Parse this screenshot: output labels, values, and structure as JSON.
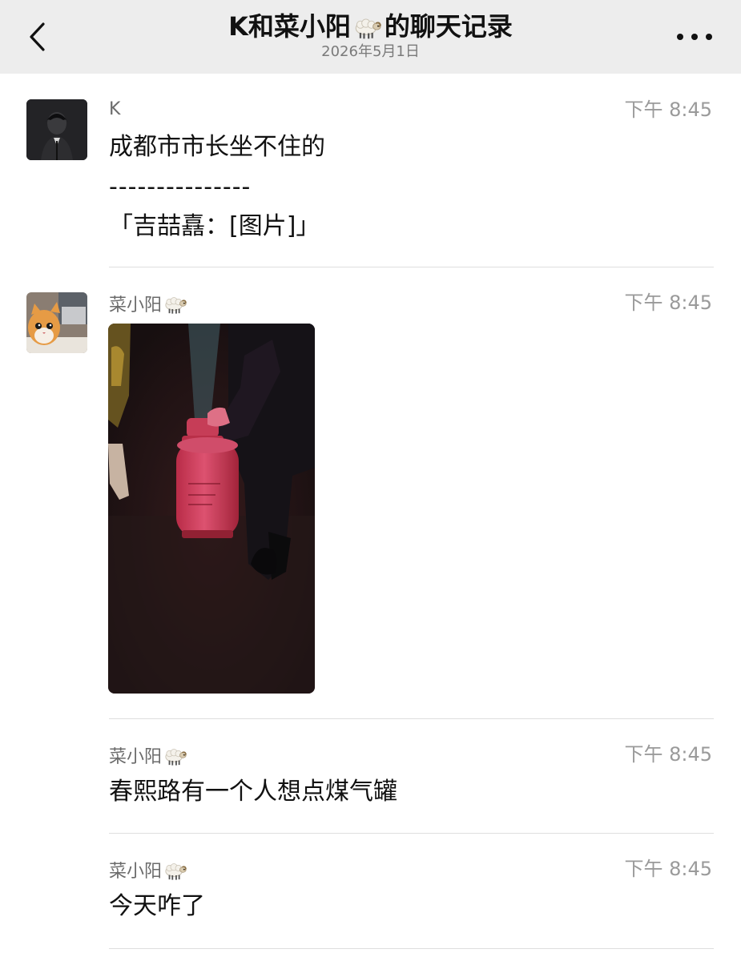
{
  "header": {
    "title_prefix": "K和菜小阳",
    "title_suffix": "的聊天记录",
    "date": "2026年5月1日",
    "back_icon": "chevron-left-icon",
    "more_icon": "more-dots-icon"
  },
  "messages": [
    {
      "sender": "K",
      "time": "下午 8:45",
      "lines": [
        "成都市市长坐不住的",
        "---------------",
        "「吉喆嚞：[图片]」"
      ]
    },
    {
      "sender": "菜小阳",
      "time": "下午 8:45",
      "type": "image"
    },
    {
      "sender": "菜小阳",
      "time": "下午 8:45",
      "text": "春熙路有一个人想点煤气罐"
    },
    {
      "sender": "菜小阳",
      "time": "下午 8:45",
      "text": "今天咋了"
    }
  ],
  "colors": {
    "header_bg": "#ededed",
    "time": "#9a9a9a",
    "sender": "#6b6b6b",
    "divider": "#dedede"
  }
}
